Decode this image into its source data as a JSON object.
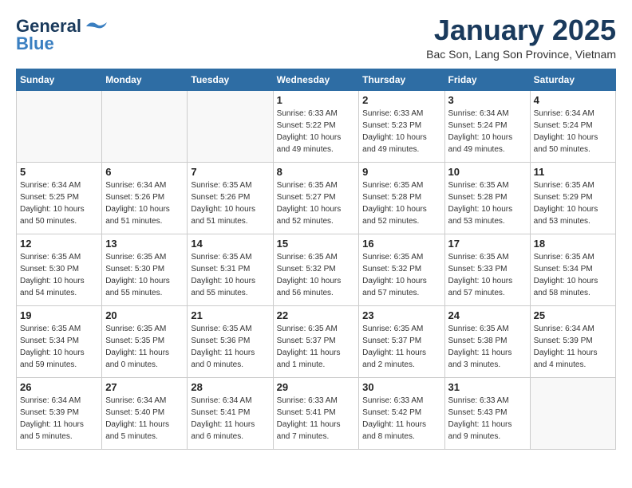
{
  "logo": {
    "general": "General",
    "blue": "Blue"
  },
  "header": {
    "title": "January 2025",
    "location": "Bac Son, Lang Son Province, Vietnam"
  },
  "weekdays": [
    "Sunday",
    "Monday",
    "Tuesday",
    "Wednesday",
    "Thursday",
    "Friday",
    "Saturday"
  ],
  "weeks": [
    [
      {
        "day": "",
        "info": ""
      },
      {
        "day": "",
        "info": ""
      },
      {
        "day": "",
        "info": ""
      },
      {
        "day": "1",
        "info": "Sunrise: 6:33 AM\nSunset: 5:22 PM\nDaylight: 10 hours\nand 49 minutes."
      },
      {
        "day": "2",
        "info": "Sunrise: 6:33 AM\nSunset: 5:23 PM\nDaylight: 10 hours\nand 49 minutes."
      },
      {
        "day": "3",
        "info": "Sunrise: 6:34 AM\nSunset: 5:24 PM\nDaylight: 10 hours\nand 49 minutes."
      },
      {
        "day": "4",
        "info": "Sunrise: 6:34 AM\nSunset: 5:24 PM\nDaylight: 10 hours\nand 50 minutes."
      }
    ],
    [
      {
        "day": "5",
        "info": "Sunrise: 6:34 AM\nSunset: 5:25 PM\nDaylight: 10 hours\nand 50 minutes."
      },
      {
        "day": "6",
        "info": "Sunrise: 6:34 AM\nSunset: 5:26 PM\nDaylight: 10 hours\nand 51 minutes."
      },
      {
        "day": "7",
        "info": "Sunrise: 6:35 AM\nSunset: 5:26 PM\nDaylight: 10 hours\nand 51 minutes."
      },
      {
        "day": "8",
        "info": "Sunrise: 6:35 AM\nSunset: 5:27 PM\nDaylight: 10 hours\nand 52 minutes."
      },
      {
        "day": "9",
        "info": "Sunrise: 6:35 AM\nSunset: 5:28 PM\nDaylight: 10 hours\nand 52 minutes."
      },
      {
        "day": "10",
        "info": "Sunrise: 6:35 AM\nSunset: 5:28 PM\nDaylight: 10 hours\nand 53 minutes."
      },
      {
        "day": "11",
        "info": "Sunrise: 6:35 AM\nSunset: 5:29 PM\nDaylight: 10 hours\nand 53 minutes."
      }
    ],
    [
      {
        "day": "12",
        "info": "Sunrise: 6:35 AM\nSunset: 5:30 PM\nDaylight: 10 hours\nand 54 minutes."
      },
      {
        "day": "13",
        "info": "Sunrise: 6:35 AM\nSunset: 5:30 PM\nDaylight: 10 hours\nand 55 minutes."
      },
      {
        "day": "14",
        "info": "Sunrise: 6:35 AM\nSunset: 5:31 PM\nDaylight: 10 hours\nand 55 minutes."
      },
      {
        "day": "15",
        "info": "Sunrise: 6:35 AM\nSunset: 5:32 PM\nDaylight: 10 hours\nand 56 minutes."
      },
      {
        "day": "16",
        "info": "Sunrise: 6:35 AM\nSunset: 5:32 PM\nDaylight: 10 hours\nand 57 minutes."
      },
      {
        "day": "17",
        "info": "Sunrise: 6:35 AM\nSunset: 5:33 PM\nDaylight: 10 hours\nand 57 minutes."
      },
      {
        "day": "18",
        "info": "Sunrise: 6:35 AM\nSunset: 5:34 PM\nDaylight: 10 hours\nand 58 minutes."
      }
    ],
    [
      {
        "day": "19",
        "info": "Sunrise: 6:35 AM\nSunset: 5:34 PM\nDaylight: 10 hours\nand 59 minutes."
      },
      {
        "day": "20",
        "info": "Sunrise: 6:35 AM\nSunset: 5:35 PM\nDaylight: 11 hours\nand 0 minutes."
      },
      {
        "day": "21",
        "info": "Sunrise: 6:35 AM\nSunset: 5:36 PM\nDaylight: 11 hours\nand 0 minutes."
      },
      {
        "day": "22",
        "info": "Sunrise: 6:35 AM\nSunset: 5:37 PM\nDaylight: 11 hours\nand 1 minute."
      },
      {
        "day": "23",
        "info": "Sunrise: 6:35 AM\nSunset: 5:37 PM\nDaylight: 11 hours\nand 2 minutes."
      },
      {
        "day": "24",
        "info": "Sunrise: 6:35 AM\nSunset: 5:38 PM\nDaylight: 11 hours\nand 3 minutes."
      },
      {
        "day": "25",
        "info": "Sunrise: 6:34 AM\nSunset: 5:39 PM\nDaylight: 11 hours\nand 4 minutes."
      }
    ],
    [
      {
        "day": "26",
        "info": "Sunrise: 6:34 AM\nSunset: 5:39 PM\nDaylight: 11 hours\nand 5 minutes."
      },
      {
        "day": "27",
        "info": "Sunrise: 6:34 AM\nSunset: 5:40 PM\nDaylight: 11 hours\nand 5 minutes."
      },
      {
        "day": "28",
        "info": "Sunrise: 6:34 AM\nSunset: 5:41 PM\nDaylight: 11 hours\nand 6 minutes."
      },
      {
        "day": "29",
        "info": "Sunrise: 6:33 AM\nSunset: 5:41 PM\nDaylight: 11 hours\nand 7 minutes."
      },
      {
        "day": "30",
        "info": "Sunrise: 6:33 AM\nSunset: 5:42 PM\nDaylight: 11 hours\nand 8 minutes."
      },
      {
        "day": "31",
        "info": "Sunrise: 6:33 AM\nSunset: 5:43 PM\nDaylight: 11 hours\nand 9 minutes."
      },
      {
        "day": "",
        "info": ""
      }
    ]
  ]
}
